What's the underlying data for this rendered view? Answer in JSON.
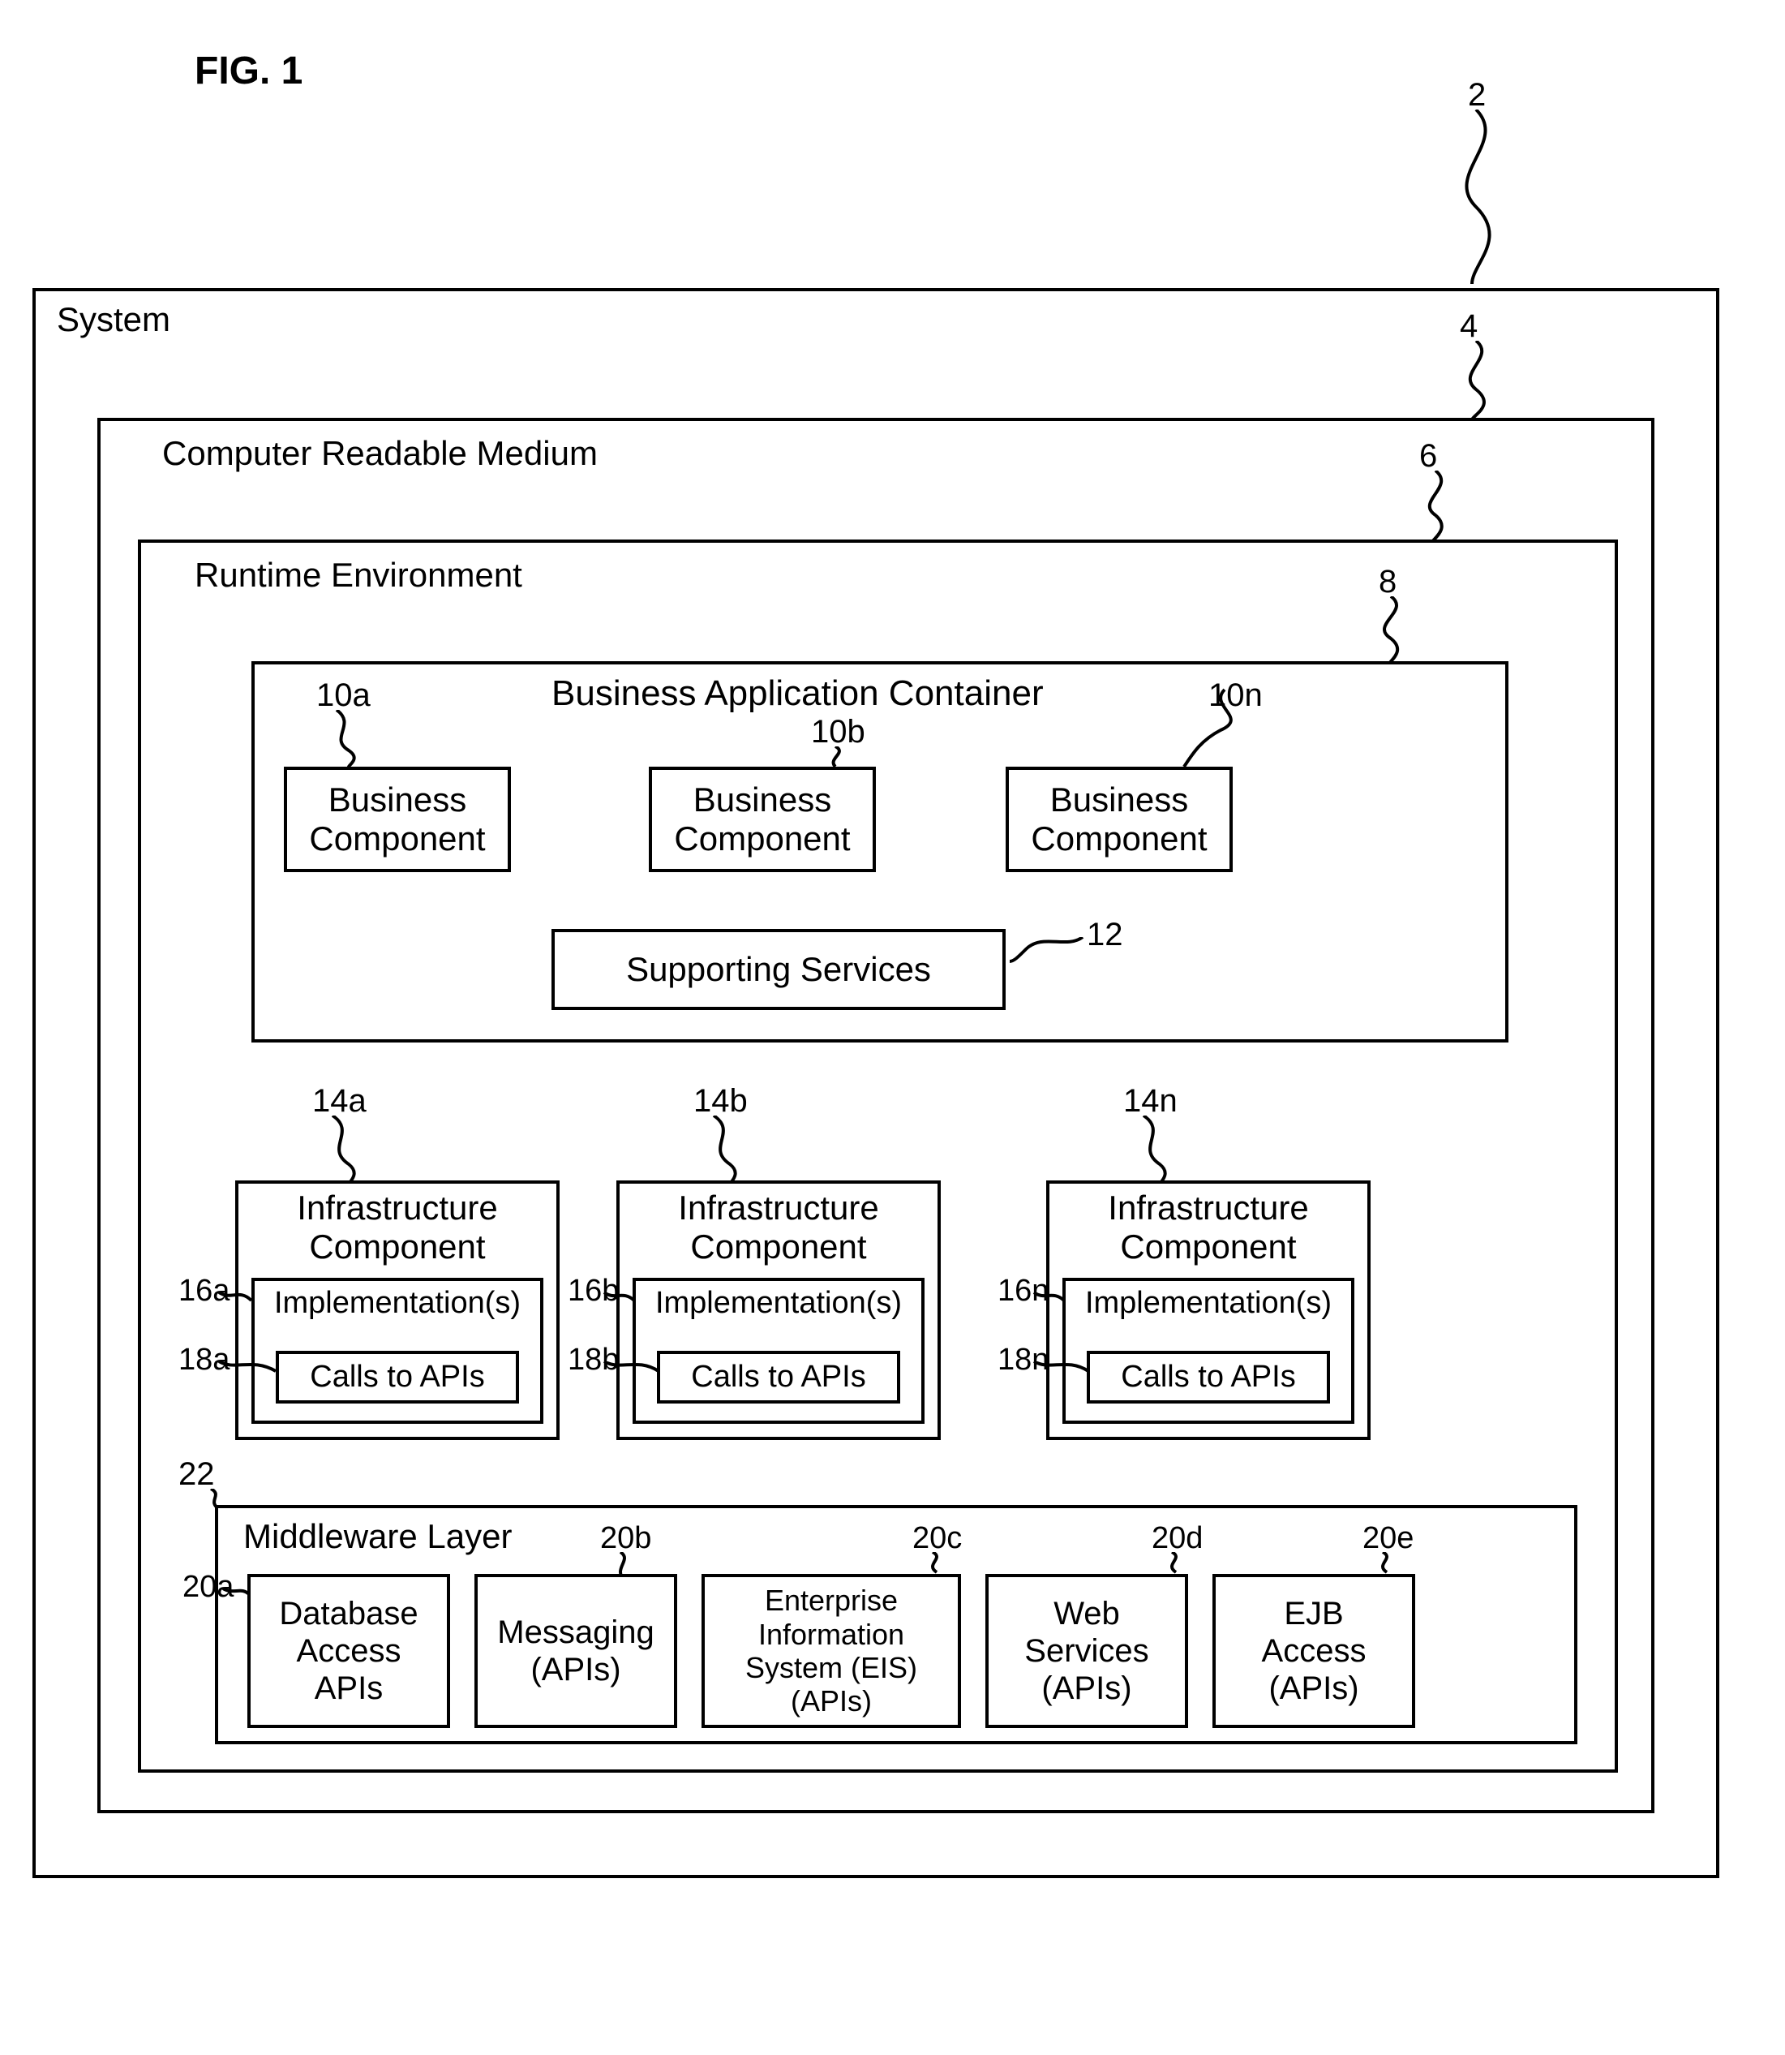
{
  "figure": "FIG. 1",
  "refs": {
    "r2": "2",
    "r4": "4",
    "r6": "6",
    "r8": "8",
    "r10a": "10a",
    "r10b": "10b",
    "r10n": "10n",
    "r12": "12",
    "r14a": "14a",
    "r14b": "14b",
    "r14n": "14n",
    "r16a": "16a",
    "r16b": "16b",
    "r16n": "16n",
    "r18a": "18a",
    "r18b": "18b",
    "r18n": "18n",
    "r20a": "20a",
    "r20b": "20b",
    "r20c": "20c",
    "r20d": "20d",
    "r20e": "20e",
    "r22": "22"
  },
  "boxes": {
    "system": "System",
    "medium": "Computer Readable Medium",
    "runtime": "Runtime Environment",
    "container": "Business Application Container",
    "biz_a": "Business\nComponent",
    "biz_b": "Business\nComponent",
    "biz_n": "Business\nComponent",
    "supporting": "Supporting Services",
    "infra_a": "Infrastructure\nComponent",
    "infra_b": "Infrastructure\nComponent",
    "infra_n": "Infrastructure\nComponent",
    "impl_a": "Implementation(s)",
    "impl_b": "Implementation(s)",
    "impl_n": "Implementation(s)",
    "calls_a": "Calls to APIs",
    "calls_b": "Calls to APIs",
    "calls_n": "Calls to APIs",
    "middleware": "Middleware Layer",
    "db": "Database\nAccess\nAPIs",
    "msg": "Messaging\n(APIs)",
    "eis": "Enterprise\nInformation\nSystem (EIS)\n(APIs)",
    "web": "Web\nServices\n(APIs)",
    "ejb": "EJB\nAccess\n(APIs)"
  }
}
